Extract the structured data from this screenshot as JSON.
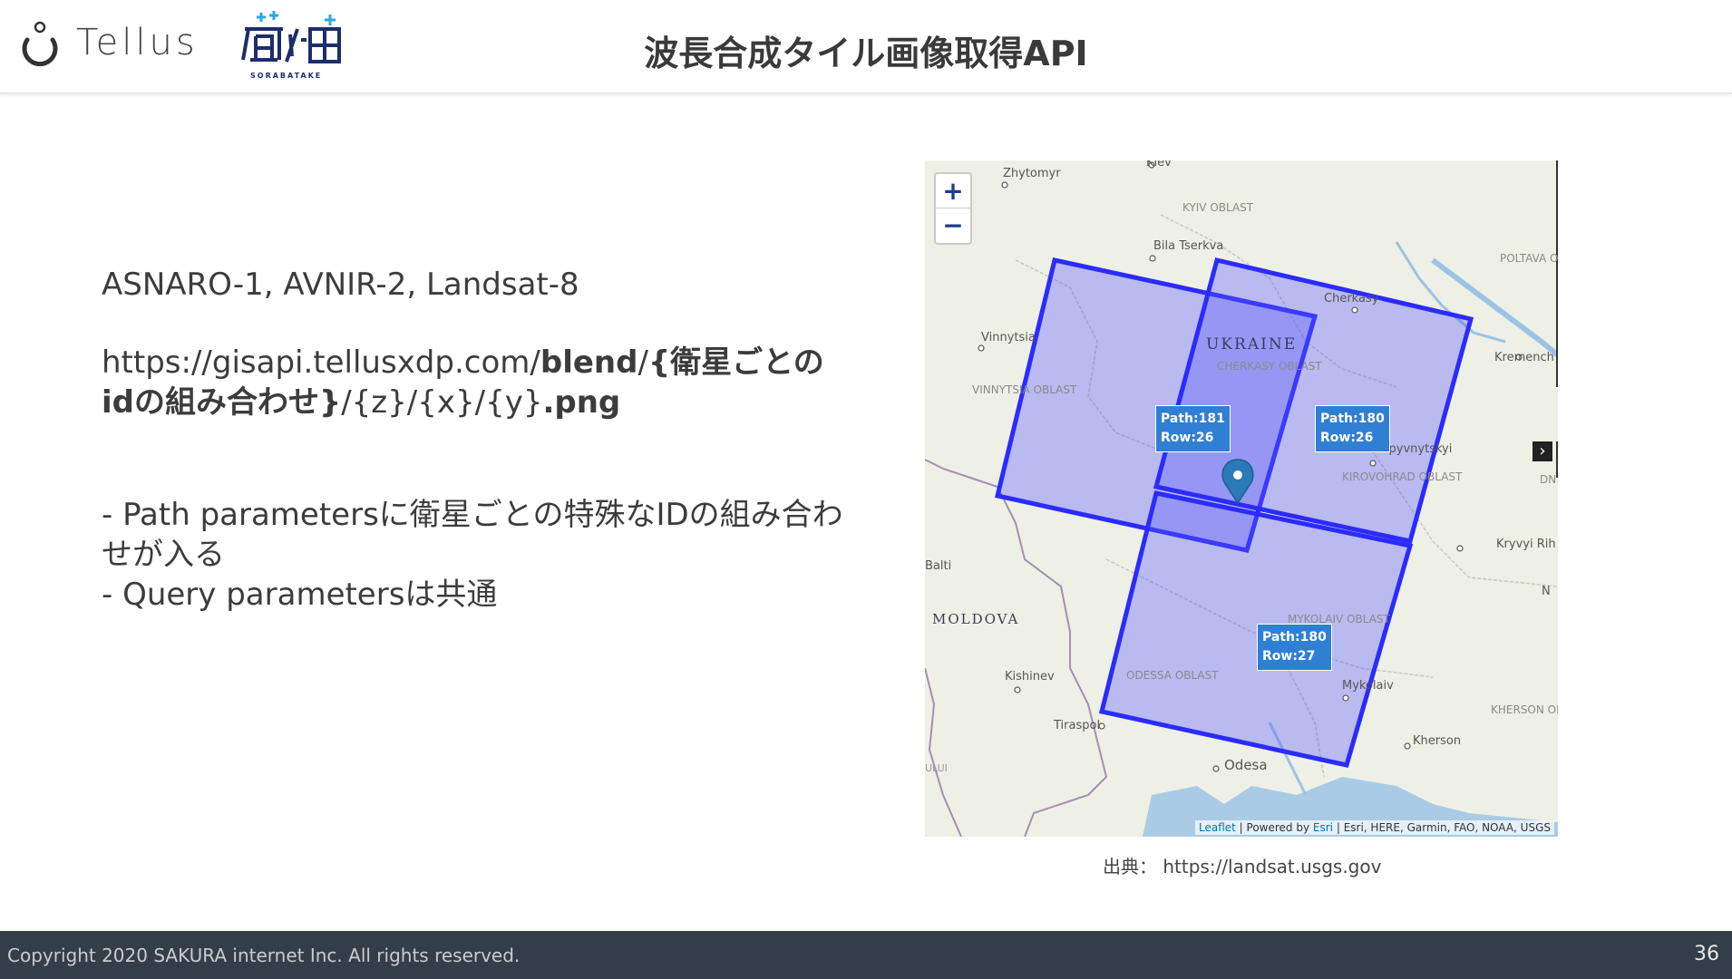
{
  "header": {
    "logo_text": "Tellus",
    "title": "波長合成タイル画像取得API"
  },
  "content": {
    "sensors": "ASNARO-1, AVNIR-2, Landsat-8",
    "url_prefix": "https://gisapi.tellusxdp.com/",
    "url_blend": "blend",
    "url_sep1": "/",
    "url_id": "{衛星ごとのidの組み合わせ}",
    "url_mid": "/{z}/{x}/{y}",
    "url_ext": ".png",
    "bullet1": "- Path parametersに衛星ごとの特殊なIDの組み合わせが入る",
    "bullet2": "- Query parametersは共通"
  },
  "map": {
    "zoom_in": "+",
    "zoom_out": "−",
    "places": {
      "zhytomyr": "Zhytomyr",
      "kiev": "Kiev",
      "kyiv_oblast": "KYIV OBLAST",
      "bila_tserkva": "Bila Tserkva",
      "poltava_oblast": "POLTAVA OBLAST",
      "cherkasy": "Cherkasy",
      "vinnytsia": "Vinnytsia",
      "ukraine": "UKRAINE",
      "cherkasy_oblast": "CHERKASY OBLAST",
      "kremench": "Kremench",
      "vinnytsia_oblast": "VINNYTSIA OBLAST",
      "kropyvnytskyi": "Kropyvnytskyi",
      "kirovohrad_oblast": "KIROVOHRAD OBLAST",
      "dn": "DN",
      "kryvyi_rih": "Kryvyi Rih",
      "balti": "Balti",
      "n": "N",
      "moldova": "MOLDOVA",
      "mykolaiv_oblast": "MYKOLAIV OBLAST",
      "kishinev": "Kishinev",
      "odessa_oblast": "ODESSA OBLAST",
      "mykolaiv": "Mykolaiv",
      "kherson_oblast": "KHERSON OBLAST",
      "tiraspol": "Tiraspol",
      "kherson": "Kherson",
      "odesa": "Odesa",
      "ului": "ULUI"
    },
    "scenes": [
      {
        "path": "Path:181",
        "row": "Row:26"
      },
      {
        "path": "Path:180",
        "row": "Row:26"
      },
      {
        "path": "Path:180",
        "row": "Row:27"
      }
    ],
    "attribution": {
      "leaflet": "Leaflet",
      "powered": " | Powered by ",
      "esri": "Esri",
      "rest": " | Esri, HERE, Garmin, FAO, NOAA, USGS"
    },
    "colors": {
      "footprint_stroke": "#2b2bff",
      "footprint_fill": "#5555ff",
      "label_bg": "#2f7fd4"
    }
  },
  "source": "出典： https://landsat.usgs.gov",
  "footer": {
    "copyright": "Copyright 2020 SAKURA internet Inc. All rights reserved.",
    "page": "36"
  }
}
